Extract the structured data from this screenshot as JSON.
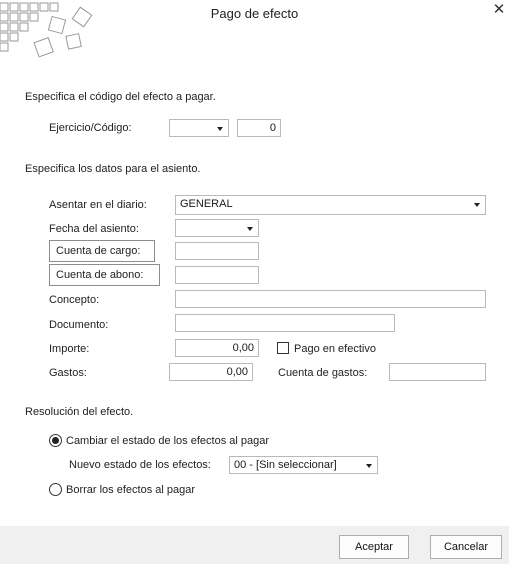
{
  "window": {
    "title": "Pago de efecto",
    "close_icon": "close-icon"
  },
  "section1": {
    "heading": "Especifica el código del efecto a pagar.",
    "ejercicio_label": "Ejercicio/Código:",
    "ejercicio_value": "",
    "codigo_value": "0"
  },
  "section2": {
    "heading": "Especifica los datos para el asiento.",
    "diario_label": "Asentar en el diario:",
    "diario_value": "GENERAL",
    "fecha_label": "Fecha del asiento:",
    "fecha_value": "",
    "cuenta_cargo_label": "Cuenta de cargo:",
    "cuenta_cargo_value": "",
    "cuenta_abono_label": "Cuenta de abono:",
    "cuenta_abono_value": "",
    "concepto_label": "Concepto:",
    "concepto_value": "",
    "documento_label": "Documento:",
    "documento_value": "",
    "importe_label": "Importe:",
    "importe_value": "0,00",
    "pago_efectivo_label": "Pago en efectivo",
    "pago_efectivo_checked": false,
    "gastos_label": "Gastos:",
    "gastos_value": "0,00",
    "cuenta_gastos_label": "Cuenta de gastos:",
    "cuenta_gastos_value": ""
  },
  "section3": {
    "heading": "Resolución del efecto.",
    "option_cambiar_label": "Cambiar el estado de los efectos al pagar",
    "option_cambiar_selected": true,
    "nuevo_estado_label": "Nuevo estado de los efectos:",
    "nuevo_estado_value": "00 - [Sin seleccionar]",
    "option_borrar_label": "Borrar los efectos al pagar",
    "option_borrar_selected": false
  },
  "footer": {
    "aceptar_label": "Aceptar",
    "cancelar_label": "Cancelar"
  },
  "colors": {
    "background": "#ffffff",
    "footer": "#f0f0f0",
    "border": "#b9b9b9"
  }
}
